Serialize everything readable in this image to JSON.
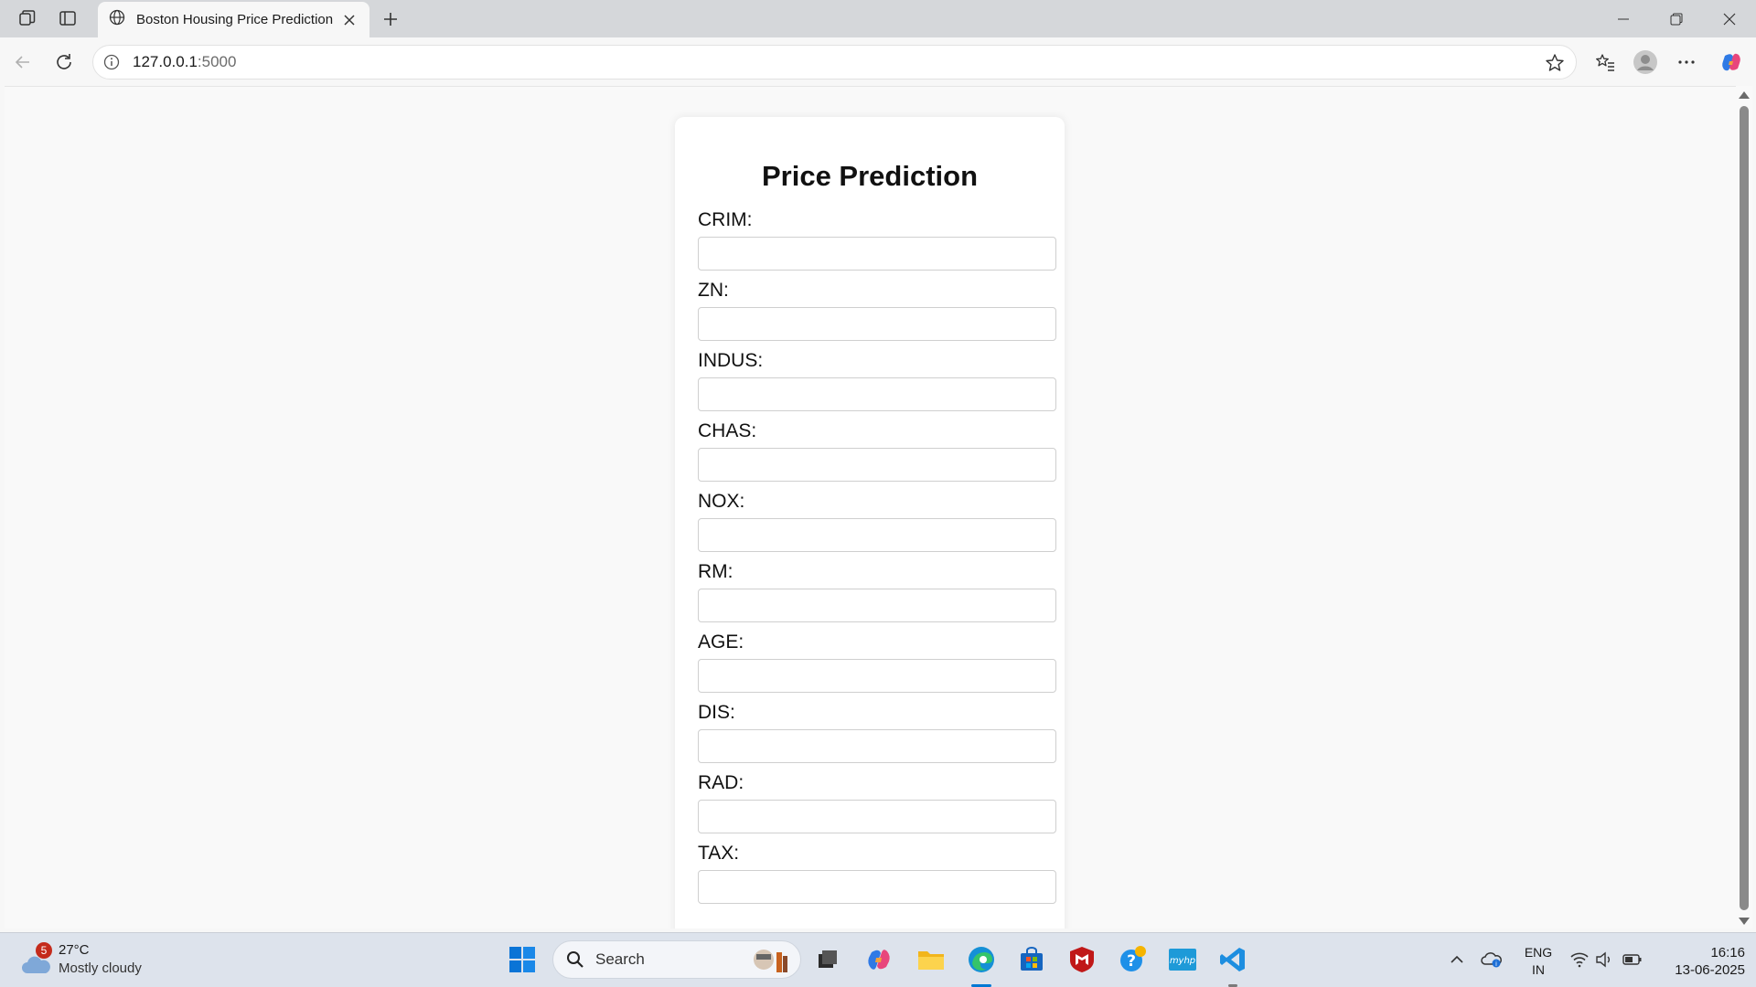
{
  "browser": {
    "tab_title": "Boston Housing Price Prediction",
    "url_host": "127.0.0.1",
    "url_port": ":5000"
  },
  "page": {
    "title": "Price Prediction",
    "fields": [
      {
        "label": "CRIM:",
        "value": ""
      },
      {
        "label": "ZN:",
        "value": ""
      },
      {
        "label": "INDUS:",
        "value": ""
      },
      {
        "label": "CHAS:",
        "value": ""
      },
      {
        "label": "NOX:",
        "value": ""
      },
      {
        "label": "RM:",
        "value": ""
      },
      {
        "label": "AGE:",
        "value": ""
      },
      {
        "label": "DIS:",
        "value": ""
      },
      {
        "label": "RAD:",
        "value": ""
      },
      {
        "label": "TAX:",
        "value": ""
      }
    ]
  },
  "taskbar": {
    "weather_badge": "5",
    "weather_temp": "27°C",
    "weather_condition": "Mostly cloudy",
    "search_label": "Search",
    "lang_top": "ENG",
    "lang_bottom": "IN",
    "time": "16:16",
    "date": "13-06-2025"
  },
  "colors": {
    "accent": "#0078d4",
    "titlebar": "#d5d7da",
    "taskbar": "#dde3ec"
  }
}
